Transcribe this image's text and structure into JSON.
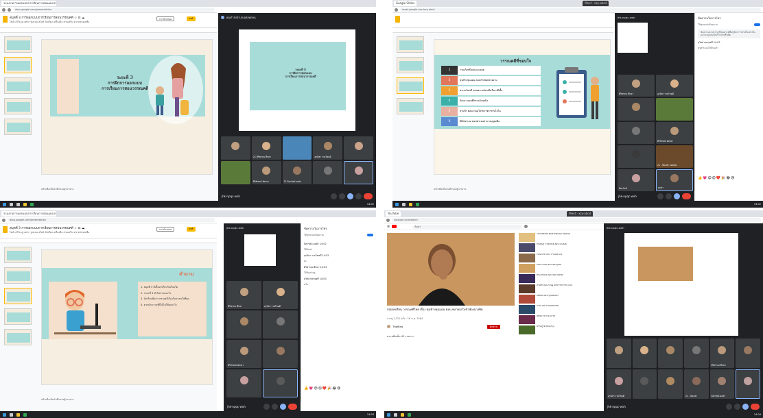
{
  "q1": {
    "tab_slides": "รวมงานการออกแบบการเรียนการสอนแบบวรรณคดี",
    "tab_meet": "Meet - xzy-abcd",
    "slides_title": "สมุดที่ 3 การออกแบบการเรียนการสอนวรรณคดี ☆ ⊡ ☁",
    "slides_menu": "ไฟล์  แก้ไข  ดู  แทรก  รูปแบบ  สไลด์  จัดเรียง  เครื่องมือ  ส่วนเสริม  ความช่วยเหลือ",
    "slideshow_btn": "การนำเสนอ",
    "share_btn": "แชร์",
    "slide_line1": "ระยะที่ 3",
    "slide_line2": "การฝึกการออกแบบ",
    "slide_line3": "การเรียนการสอนวรรณคดี",
    "notes": "คลิกเพื่อเพิ่มบันทึกของผู้บรรยาย",
    "meet_presenting": "คุณกำลังนำเสนอต่อทุกคน",
    "tiles": [
      "",
      "21 ศิริพรรณ ศึกษา",
      "",
      "อุรนิสา รวยโชคดี",
      "",
      "",
      "ศิริลักษณ์ อัศวยา",
      "21 ธิดารัตน์ ผลคำ",
      "",
      ""
    ],
    "meet_code": "jhk-npqc-woh",
    "time": "14:02"
  },
  "q2": {
    "tab_meet": "Meet - xzy-abcd",
    "slide_heading": "วรรณคดีที่ชอบใจ",
    "list": [
      {
        "num": "1",
        "text": "รามเกียรติ์ ตอนนางลอย"
      },
      {
        "num": "2",
        "text": "ขุนช้างขุนแผน ตอนกำเนิดพลายงาม"
      },
      {
        "num": "3",
        "text": "พระอภัยมณี ตอนพระอภัยมณีหนีนางผีเสื้อ"
      },
      {
        "num": "4",
        "text": "อิเหนา ตอนศึกกะหมังกุหนิง"
      },
      {
        "num": "5",
        "text": "สามก๊ก ตอนกวนอูไปรับราชการกับโจโฉ"
      },
      {
        "num": "6",
        "text": "ลิลิตพระลอ ตอนพระลอลานางบุญเหลือ"
      }
    ],
    "chat_title": "ข้อความในการโทร",
    "chat_toggle": "ให้ทุกคนส่งข้อความ",
    "chat_note": "ข้อความจะปรากฏให้เฉพาะผู้ที่อยู่ในการโทรเห็นเท่านั้น และจะถูกลบเมื่อการโทรสิ้นสุด",
    "msg1": "สุวิทย์ พรหมศรี  14:02",
    "msg2": "ครูครับ ผมได้ยินแล้ว",
    "tiles": [
      "ศิริพรรณ ศึกษา",
      "อุรนิสา รวยโชคดี",
      "",
      "",
      "",
      "ศิริลักษณ์ อัศวยา",
      "",
      "21 - ปิยะพร กองทอง",
      "ธิดารัตน์",
      "ผลคำ"
    ],
    "emoji": "👍💗😊😮❤️🎉😂😢",
    "notes": "คลิกเพื่อเพิ่มบันทึกของผู้บรรยาย",
    "meet_code": "jhk-npqc-woh",
    "time": "14:02"
  },
  "q3": {
    "tab_slides": "รวมงานการออกแบบการเรียนการสอนแบบวรรณคดี",
    "slides_title": "สมุดที่ 3 การออกแบบการเรียนการสอนวรรณคดี ☆ ⊡ ☁",
    "slides_menu": "ไฟล์  แก้ไข  ดู  แทรก  รูปแบบ  สไลด์  จัดเรียง  เครื่องมือ  ส่วนเสริม  ความช่วยเหลือ",
    "slideshow_btn": "การนำเสนอ",
    "share_btn": "แชร์",
    "slide_heading": "คำถาม",
    "questions": [
      "1. สมุดที่ 3 มีเนื้อหาเกี่ยวกับเรื่องใด",
      "2. ระยะที่ 3 ทำกิจกรรมอะไร",
      "3. นักเรียนคิดว่าวรรณคดีเรื่องใดน่าสนใจที่สุด",
      "4. ควรนำความรู้ที่ได้ไปใช้อย่างไร"
    ],
    "chat_title": "ข้อความในการโทร",
    "chat_toggle": "ให้ทุกคนส่งข้อความ",
    "chat_msgs": [
      "ธิดารัตน์ ผลคำ  14:02",
      "ได้ยินค่ะ",
      "อุรนิสา รวยโชคดี  14:02",
      "ค่ะ",
      "ศิริพรรณ ศึกษา  14:03",
      "ได้ยินค่ะครู",
      "สุวิทย์ พรหมศรี  14:03",
      "ครับ"
    ],
    "tiles": [
      "ศิริพรรณ ศึกษา",
      "อุรนิสา รวยโชคดี",
      "",
      "",
      "ศิริลักษณ์ อัศวยา",
      "",
      "",
      ""
    ],
    "emoji": "👍💗😊😮❤️🎉😂😢",
    "notes": "คลิกเพื่อเพิ่มบันทึกของผู้บรรยาย",
    "meet_code": "jhk-npqc-woh",
    "time": "14:03"
  },
  "q4": {
    "tab_yt": "YouTube",
    "tab_meet": "Meet - xzy-abcd",
    "yt_search": "ค้นหา",
    "video_title": "สรุปบทเรียน วรรณคดีไทย เรื่อง ขุนช้างขุนแผน ตอน พลายแก้วเข้าห้องนางพิม",
    "video_meta": "การดู 2,221 ครั้ง · 16 ม.ค. 2564",
    "channel": "ThaiEdu",
    "subscribe": "ติดตาม",
    "comments_label": "ความคิดเห็น 42 รายการ",
    "sidebar": [
      "วรรณคดีไทย ขุนช้างขุนแผน สรุปเรื่อง",
      "สรุปเรื่อง รามเกียรติ์ ตอน นางลอย",
      "เรียนภาษาไทย วรรณคดี ม.6",
      "อิเหนา ตอน ศึกกะหมังกุหนิง",
      "พระอภัยมณี ตอน หนีนางผีเสื้อ",
      "สามก๊ก ตอน กวนอูไปรับราชการกับโจโฉ",
      "ลิลิตพระลอ สรุปเนื้อเรื่อง",
      "ภาษาไทย วรรณคดีวิจักษ์",
      "เพลงยาวถวายโอวาท",
      "นิราศภูเขาทอง สรุป"
    ],
    "tiles": [
      "",
      "",
      "",
      "",
      "ศิริพรรณ ศึกษา",
      "",
      "อุรนิสา รวยโชคดี",
      "",
      "",
      "21 - ปิยะพร",
      "ธิดารัตน์ ผลคำ",
      ""
    ],
    "meet_code": "jhk-npqc-woh",
    "time": "14:04"
  }
}
